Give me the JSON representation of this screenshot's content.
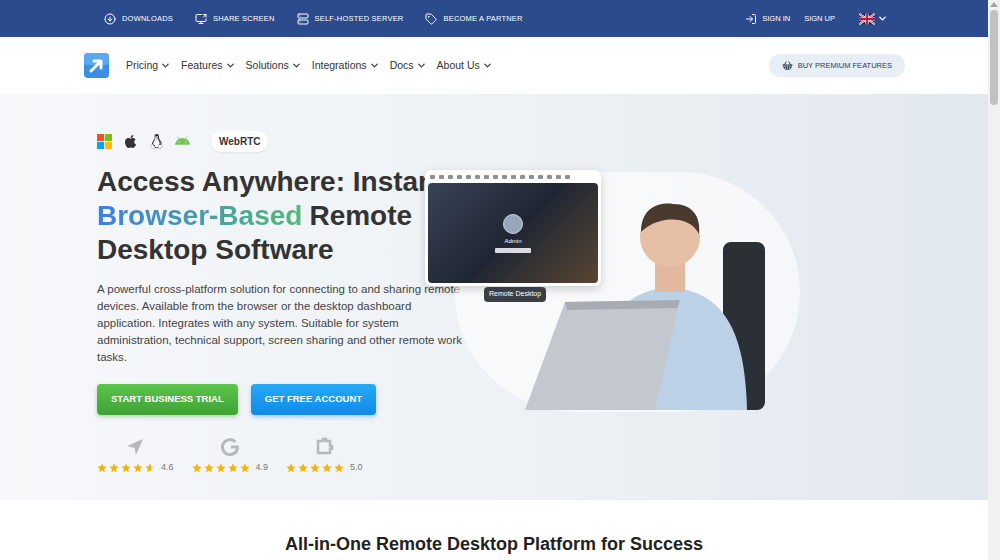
{
  "topbar": {
    "links": [
      {
        "label": "DOWNLOADS"
      },
      {
        "label": "SHARE SCREEN"
      },
      {
        "label": "SELF-HOSTED SERVER"
      },
      {
        "label": "BECOME A PARTNER"
      }
    ],
    "sign_in": "SIGN IN",
    "sign_up": "SIGN UP"
  },
  "nav": {
    "items": [
      "Pricing",
      "Features",
      "Solutions",
      "Integrations",
      "Docs",
      "About Us"
    ],
    "premium_button": "BUY PREMIUM FEATURES"
  },
  "hero": {
    "badge": "WebRTC",
    "title_line1": "Access Anywhere: Instant",
    "title_highlight": "Browser-Based",
    "title_rest": "Remote",
    "title_line3": "Desktop Software",
    "description": "A powerful cross-platform solution for connecting to and sharing remote devices. Available from the browser or the desktop dashboard application. Integrates with any system. Suitable for system administration, technical support, screen sharing and other remote work tasks.",
    "buttons": [
      {
        "label": "START BUSINESS TRIAL",
        "kind": "trial"
      },
      {
        "label": "GET FREE ACCOUNT",
        "kind": "free"
      }
    ],
    "ratings": [
      {
        "score": "4.6",
        "stars": 4.6
      },
      {
        "score": "4.9",
        "stars": 4.9
      },
      {
        "score": "5.0",
        "stars": 5
      }
    ],
    "preview": {
      "user": "Admin",
      "label": "Remote Desktop"
    }
  },
  "section": {
    "title": "All-in-One Remote Desktop Platform for Success"
  }
}
